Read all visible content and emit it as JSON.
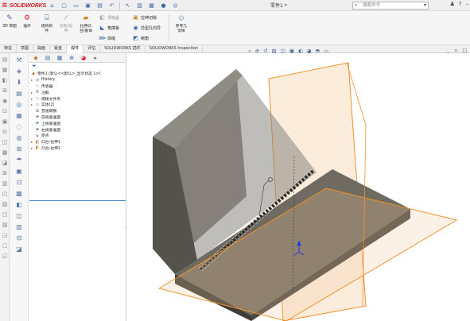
{
  "app": {
    "logo_text": "SOLIDWORKS",
    "document_title": "零件1 *",
    "search_placeholder": "搜索命令"
  },
  "ribbon": {
    "commands": [
      {
        "label": "3D 草图"
      },
      {
        "label": "插件"
      },
      {
        "label": "结构构\n件"
      },
      {
        "label": "剪裁/延\n伸"
      },
      {
        "label": "拉伸凸\n台/基体"
      }
    ],
    "small_buttons": [
      {
        "label": "顶端盖",
        "dim": true
      },
      {
        "label": "角撑板"
      },
      {
        "label": "焊缝"
      },
      {
        "label": "拉伸切除"
      },
      {
        "label": "异型孔向导"
      },
      {
        "label": "倒角"
      }
    ],
    "geometry": {
      "label": "参考几\n何体"
    }
  },
  "tabs": [
    "特征",
    "草图",
    "曲面",
    "钣金",
    "焊件",
    "评估",
    "SOLIDWORKS 插件",
    "SOLIDWORKS Inspection"
  ],
  "active_tab": "焊件",
  "tree": {
    "root": "零件1 (默认<<默认>_显示状态 1>)",
    "items": [
      {
        "label": "History",
        "expand": true
      },
      {
        "label": "传感器",
        "expand": false
      },
      {
        "label": "注解",
        "expand": true
      },
      {
        "label": "焊接文件夹",
        "expand": true
      },
      {
        "label": "实体(2)",
        "expand": true
      },
      {
        "label": "普通碳钢",
        "expand": false
      },
      {
        "label": "前视基准面",
        "expand": false
      },
      {
        "label": "上视基准面",
        "expand": false
      },
      {
        "label": "右视基准面",
        "expand": false
      },
      {
        "label": "原点",
        "expand": false
      },
      {
        "label": "凸台-拉伸1",
        "expand": true
      },
      {
        "label": "凸台-拉伸2",
        "expand": true
      }
    ]
  },
  "colors": {
    "plate": "#5d5a52",
    "plate_dark": "#3e3c37",
    "plane_edge": "#f0922b",
    "weld_bead": "#2b2a27",
    "brand": "#d21f26"
  }
}
